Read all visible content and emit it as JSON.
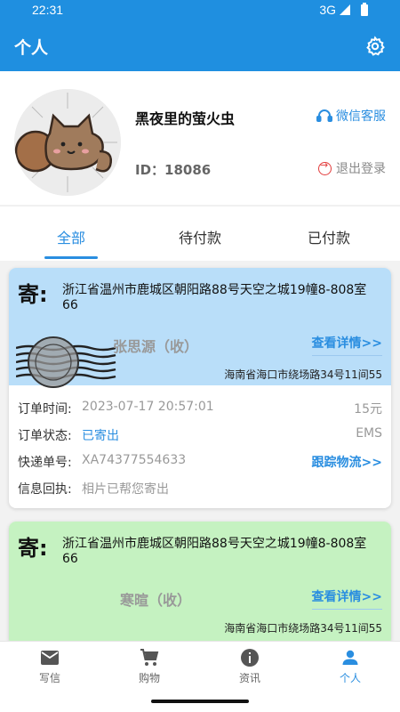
{
  "status": {
    "time": "22:31",
    "network": "3G"
  },
  "app_bar": {
    "title": "个人"
  },
  "profile": {
    "nickname": "黑夜里的萤火虫",
    "id_text": "ID：18086",
    "wechat_label": "微信客服",
    "logout_label": "退出登录"
  },
  "tabs": [
    {
      "label": "全部",
      "active": true
    },
    {
      "label": "待付款",
      "active": false
    },
    {
      "label": "已付款",
      "active": false
    }
  ],
  "orders": [
    {
      "color": "#b9def9",
      "ji_label": "寄:",
      "sender_address": "浙江省温州市鹿城区朝阳路88号天空之城19幢8-808室66",
      "receiver": "张思源（收）",
      "detail_label": "查看详情>>",
      "to_address": "海南省海口市绕场路34号11间55",
      "time_label": "订单时间:",
      "time_value": "2023-07-17 20:57:01",
      "price": "15元",
      "status_label": "订单状态:",
      "status_value": "已寄出",
      "carrier": "EMS",
      "tracking_label": "快递单号:",
      "tracking_value": "XA74377554633",
      "track_link": "跟踪物流>>",
      "receipt_label": "信息回执:",
      "receipt_value": "相片已帮您寄出"
    },
    {
      "color": "#c5f2c1",
      "ji_label": "寄:",
      "sender_address": "浙江省温州市鹿城区朝阳路88号天空之城19幢8-808室66",
      "receiver": "寒暄（收）",
      "detail_label": "查看详情>>",
      "to_address": "海南省海口市绕场路34号11间55"
    }
  ],
  "bottom_nav": [
    {
      "label": "写信",
      "icon": "mail-icon"
    },
    {
      "label": "购物",
      "icon": "cart-icon"
    },
    {
      "label": "资讯",
      "icon": "info-icon"
    },
    {
      "label": "个人",
      "icon": "person-icon",
      "active": true
    }
  ]
}
